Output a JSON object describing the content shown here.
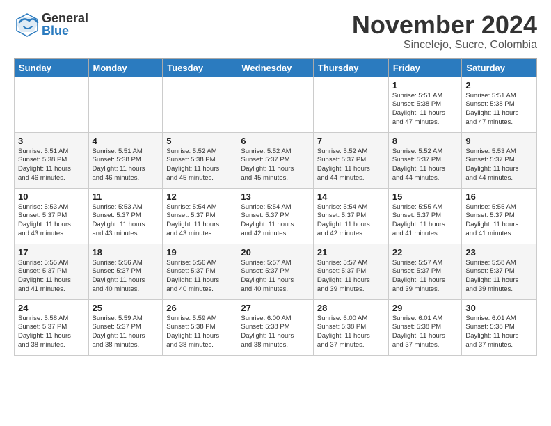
{
  "logo": {
    "general": "General",
    "blue": "Blue"
  },
  "header": {
    "month": "November 2024",
    "location": "Sincelejo, Sucre, Colombia"
  },
  "weekdays": [
    "Sunday",
    "Monday",
    "Tuesday",
    "Wednesday",
    "Thursday",
    "Friday",
    "Saturday"
  ],
  "weeks": [
    [
      {
        "day": "",
        "info": ""
      },
      {
        "day": "",
        "info": ""
      },
      {
        "day": "",
        "info": ""
      },
      {
        "day": "",
        "info": ""
      },
      {
        "day": "",
        "info": ""
      },
      {
        "day": "1",
        "info": "Sunrise: 5:51 AM\nSunset: 5:38 PM\nDaylight: 11 hours\nand 47 minutes."
      },
      {
        "day": "2",
        "info": "Sunrise: 5:51 AM\nSunset: 5:38 PM\nDaylight: 11 hours\nand 47 minutes."
      }
    ],
    [
      {
        "day": "3",
        "info": "Sunrise: 5:51 AM\nSunset: 5:38 PM\nDaylight: 11 hours\nand 46 minutes."
      },
      {
        "day": "4",
        "info": "Sunrise: 5:51 AM\nSunset: 5:38 PM\nDaylight: 11 hours\nand 46 minutes."
      },
      {
        "day": "5",
        "info": "Sunrise: 5:52 AM\nSunset: 5:38 PM\nDaylight: 11 hours\nand 45 minutes."
      },
      {
        "day": "6",
        "info": "Sunrise: 5:52 AM\nSunset: 5:37 PM\nDaylight: 11 hours\nand 45 minutes."
      },
      {
        "day": "7",
        "info": "Sunrise: 5:52 AM\nSunset: 5:37 PM\nDaylight: 11 hours\nand 44 minutes."
      },
      {
        "day": "8",
        "info": "Sunrise: 5:52 AM\nSunset: 5:37 PM\nDaylight: 11 hours\nand 44 minutes."
      },
      {
        "day": "9",
        "info": "Sunrise: 5:53 AM\nSunset: 5:37 PM\nDaylight: 11 hours\nand 44 minutes."
      }
    ],
    [
      {
        "day": "10",
        "info": "Sunrise: 5:53 AM\nSunset: 5:37 PM\nDaylight: 11 hours\nand 43 minutes."
      },
      {
        "day": "11",
        "info": "Sunrise: 5:53 AM\nSunset: 5:37 PM\nDaylight: 11 hours\nand 43 minutes."
      },
      {
        "day": "12",
        "info": "Sunrise: 5:54 AM\nSunset: 5:37 PM\nDaylight: 11 hours\nand 43 minutes."
      },
      {
        "day": "13",
        "info": "Sunrise: 5:54 AM\nSunset: 5:37 PM\nDaylight: 11 hours\nand 42 minutes."
      },
      {
        "day": "14",
        "info": "Sunrise: 5:54 AM\nSunset: 5:37 PM\nDaylight: 11 hours\nand 42 minutes."
      },
      {
        "day": "15",
        "info": "Sunrise: 5:55 AM\nSunset: 5:37 PM\nDaylight: 11 hours\nand 41 minutes."
      },
      {
        "day": "16",
        "info": "Sunrise: 5:55 AM\nSunset: 5:37 PM\nDaylight: 11 hours\nand 41 minutes."
      }
    ],
    [
      {
        "day": "17",
        "info": "Sunrise: 5:55 AM\nSunset: 5:37 PM\nDaylight: 11 hours\nand 41 minutes."
      },
      {
        "day": "18",
        "info": "Sunrise: 5:56 AM\nSunset: 5:37 PM\nDaylight: 11 hours\nand 40 minutes."
      },
      {
        "day": "19",
        "info": "Sunrise: 5:56 AM\nSunset: 5:37 PM\nDaylight: 11 hours\nand 40 minutes."
      },
      {
        "day": "20",
        "info": "Sunrise: 5:57 AM\nSunset: 5:37 PM\nDaylight: 11 hours\nand 40 minutes."
      },
      {
        "day": "21",
        "info": "Sunrise: 5:57 AM\nSunset: 5:37 PM\nDaylight: 11 hours\nand 39 minutes."
      },
      {
        "day": "22",
        "info": "Sunrise: 5:57 AM\nSunset: 5:37 PM\nDaylight: 11 hours\nand 39 minutes."
      },
      {
        "day": "23",
        "info": "Sunrise: 5:58 AM\nSunset: 5:37 PM\nDaylight: 11 hours\nand 39 minutes."
      }
    ],
    [
      {
        "day": "24",
        "info": "Sunrise: 5:58 AM\nSunset: 5:37 PM\nDaylight: 11 hours\nand 38 minutes."
      },
      {
        "day": "25",
        "info": "Sunrise: 5:59 AM\nSunset: 5:37 PM\nDaylight: 11 hours\nand 38 minutes."
      },
      {
        "day": "26",
        "info": "Sunrise: 5:59 AM\nSunset: 5:38 PM\nDaylight: 11 hours\nand 38 minutes."
      },
      {
        "day": "27",
        "info": "Sunrise: 6:00 AM\nSunset: 5:38 PM\nDaylight: 11 hours\nand 38 minutes."
      },
      {
        "day": "28",
        "info": "Sunrise: 6:00 AM\nSunset: 5:38 PM\nDaylight: 11 hours\nand 37 minutes."
      },
      {
        "day": "29",
        "info": "Sunrise: 6:01 AM\nSunset: 5:38 PM\nDaylight: 11 hours\nand 37 minutes."
      },
      {
        "day": "30",
        "info": "Sunrise: 6:01 AM\nSunset: 5:38 PM\nDaylight: 11 hours\nand 37 minutes."
      }
    ]
  ]
}
